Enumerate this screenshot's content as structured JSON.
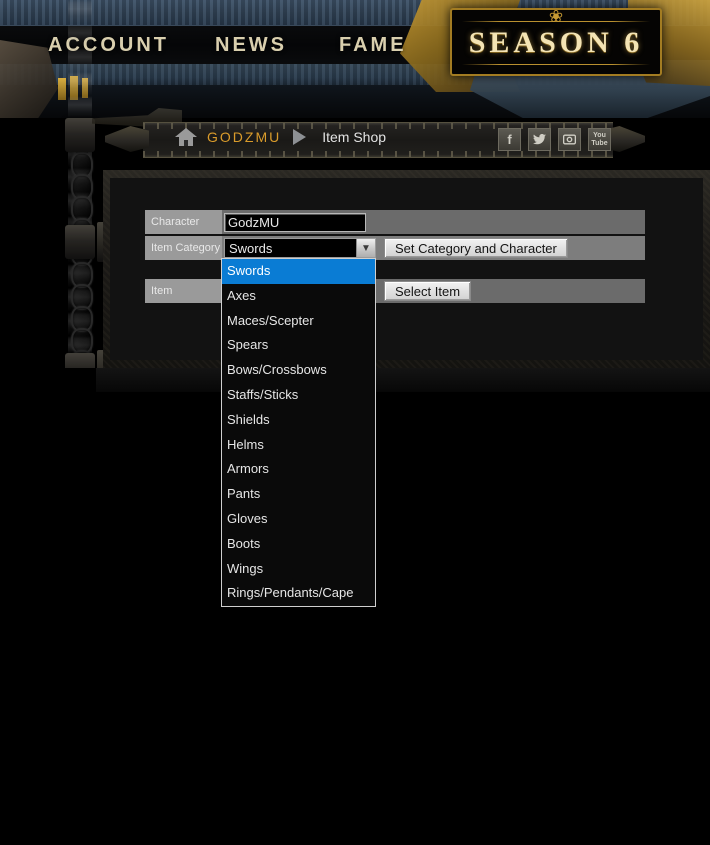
{
  "banner": {
    "nav": [
      {
        "id": "account",
        "label": "ACCOUNT"
      },
      {
        "id": "news",
        "label": "NEWS"
      },
      {
        "id": "fame",
        "label": "FAME"
      }
    ],
    "season_badge": "SEASON 6",
    "season_ornament": "❀"
  },
  "breadcrumb": {
    "home_icon": "home-icon",
    "user": "GODZMU",
    "separator_icon": "chevron-right-icon",
    "page": "Item Shop",
    "socials": [
      {
        "id": "facebook",
        "icon": "facebook-icon",
        "glyph": "f"
      },
      {
        "id": "twitter",
        "icon": "twitter-icon",
        "glyph": "ᴠ"
      },
      {
        "id": "instagram",
        "icon": "instagram-icon",
        "glyph": "▣"
      },
      {
        "id": "youtube",
        "icon": "youtube-icon",
        "glyph_top": "You",
        "glyph_bottom": "Tube"
      }
    ]
  },
  "form": {
    "character": {
      "label": "Character",
      "value": "GodzMU",
      "placeholder": ""
    },
    "item_category": {
      "label": "Item Category",
      "selected": "Swords",
      "arrow_icon": "chevron-down-icon",
      "options": [
        "Swords",
        "Axes",
        "Maces/Scepter",
        "Spears",
        "Bows/Crossbows",
        "Staffs/Sticks",
        "Shields",
        "Helms",
        "Armors",
        "Pants",
        "Gloves",
        "Boots",
        "Wings",
        "Rings/Pendants/Cape"
      ],
      "open": true,
      "button_label": "Set Category and Character"
    },
    "item": {
      "label": "Item",
      "selected": "",
      "arrow_icon": "chevron-down-icon",
      "button_label": "Select Item"
    }
  },
  "colors": {
    "accent_gold": "#d99b2b",
    "select_highlight": "#0a7cd4",
    "panel_bg": "#121212",
    "row_label_bg": "#9a9a9a",
    "season_text": "#f4e4b4"
  }
}
